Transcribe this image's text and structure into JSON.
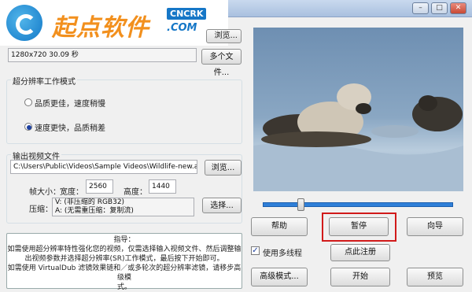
{
  "window": {
    "min_icon": "minimize-icon",
    "max_icon": "maximize-icon",
    "close_icon": "close-icon"
  },
  "logo": {
    "text": "起点软件",
    "brand": "CNCRK",
    "domain": ".COM"
  },
  "input_file": {
    "info": "1280x720 30.09 秒",
    "browse_partial": "浏览...",
    "multi_files": "多个文件..."
  },
  "mode": {
    "group_label": "超分辨率工作模式",
    "option_quality": "品质更佳，速度稍慢",
    "option_speed": "速度更快，品质稍差",
    "selected": "option_speed"
  },
  "output": {
    "group_label": "输出视频文件",
    "path": "C:\\Users\\Public\\Videos\\Sample Videos\\Wildlife-new.avi",
    "browse": "浏览...",
    "frame_size_label": "帧大小：",
    "width_label": "宽度：",
    "width_value": "2560",
    "height_label": "高度：",
    "height_value": "1440",
    "compress_label": "压缩：",
    "compress_line1": "V: (非压缩的 RGB32)",
    "compress_line2": "A: (无需重压缩：复制流)",
    "choose": "选择..."
  },
  "guide": {
    "title": "指导：",
    "line1": "如需使用超分辨率特性强化您的视频，仅需选择输入视频文件、然后调整输",
    "line2": "出视频参数并选择超分辨率(SR)工作模式，最后按下开始即可。",
    "line3": "如需使用 VirtualDub 滤镜效果链和／或多轮次的超分辨率滤镜，请移步高级模",
    "line4": "式。"
  },
  "player": {
    "progress": 0.2
  },
  "buttons": {
    "help": "帮助",
    "pause": "暂停",
    "wizard": "向导",
    "multithread": "使用多线程",
    "multithread_checked": true,
    "register": "点此注册",
    "advanced": "高级模式...",
    "start": "开始",
    "preview": "预览"
  },
  "colors": {
    "highlight": "#d11a1a",
    "slider_track": "#2f7fd8"
  }
}
